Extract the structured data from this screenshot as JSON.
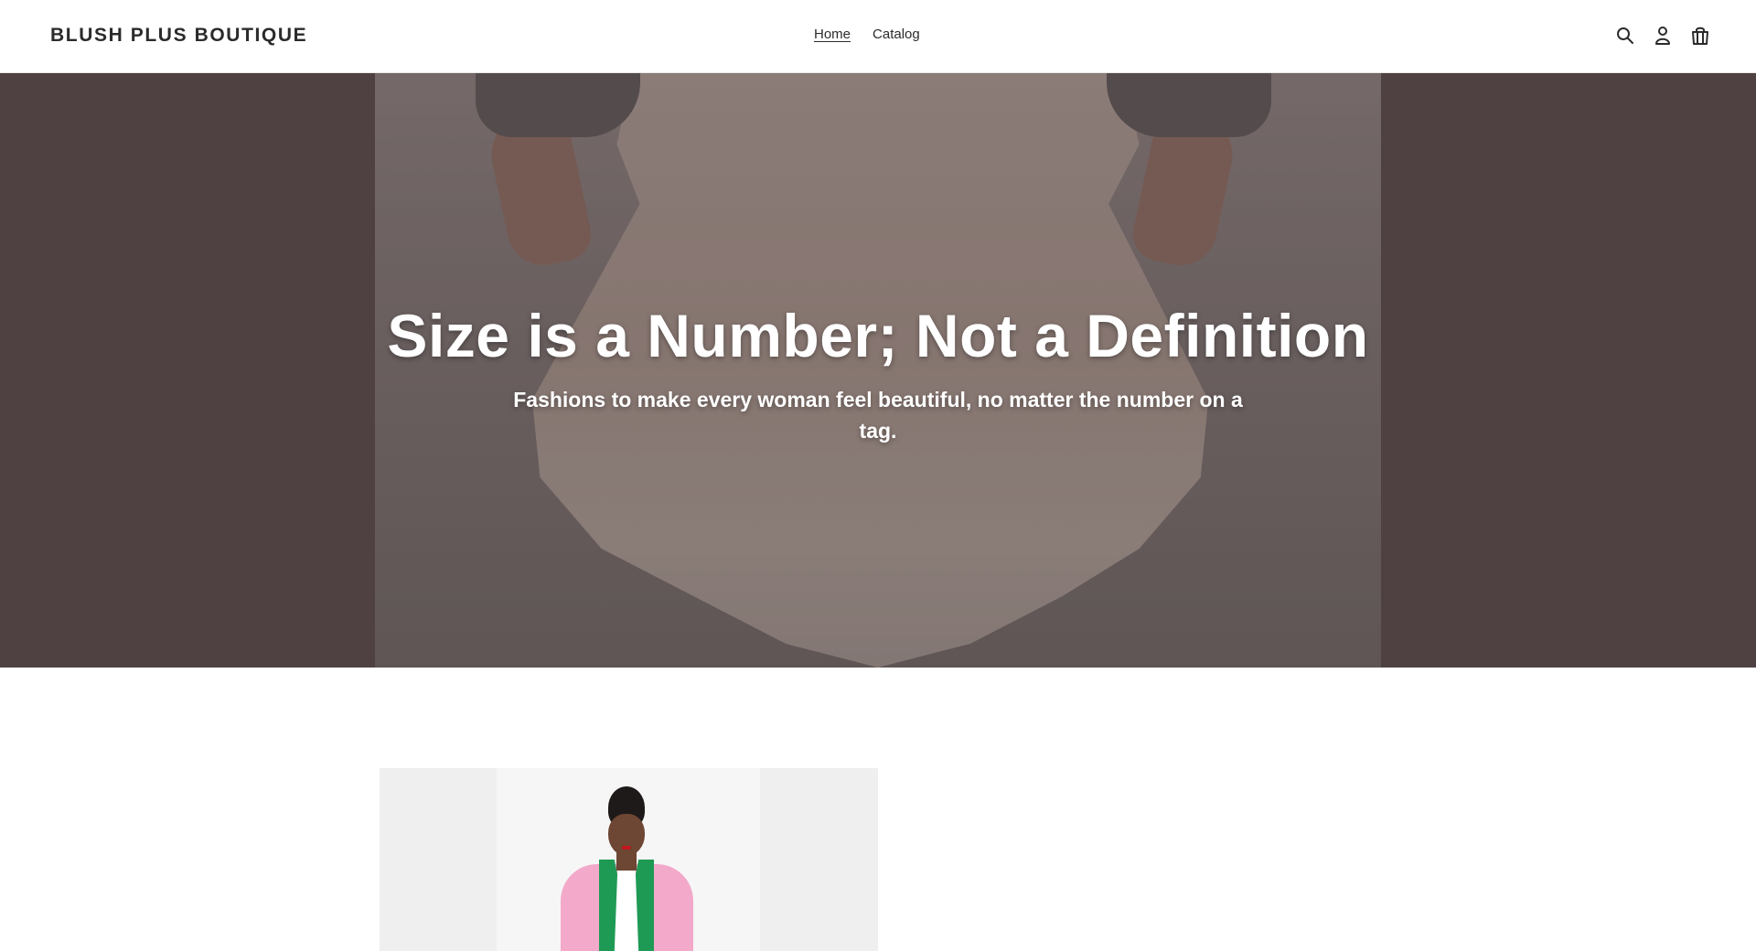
{
  "header": {
    "brand": "BLUSH PLUS BOUTIQUE",
    "nav": [
      {
        "label": "Home",
        "active": true
      },
      {
        "label": "Catalog",
        "active": false
      }
    ],
    "icons": [
      "search-icon",
      "account-icon",
      "cart-icon"
    ]
  },
  "hero": {
    "title": "Size is a Number; Not a Definition",
    "subtitle": "Fashions to make every woman feel beautiful, no matter the number on a tag."
  },
  "colors": {
    "hero_background": "#56494a",
    "header_background": "#ffffff",
    "text": "#2b2b2b"
  }
}
